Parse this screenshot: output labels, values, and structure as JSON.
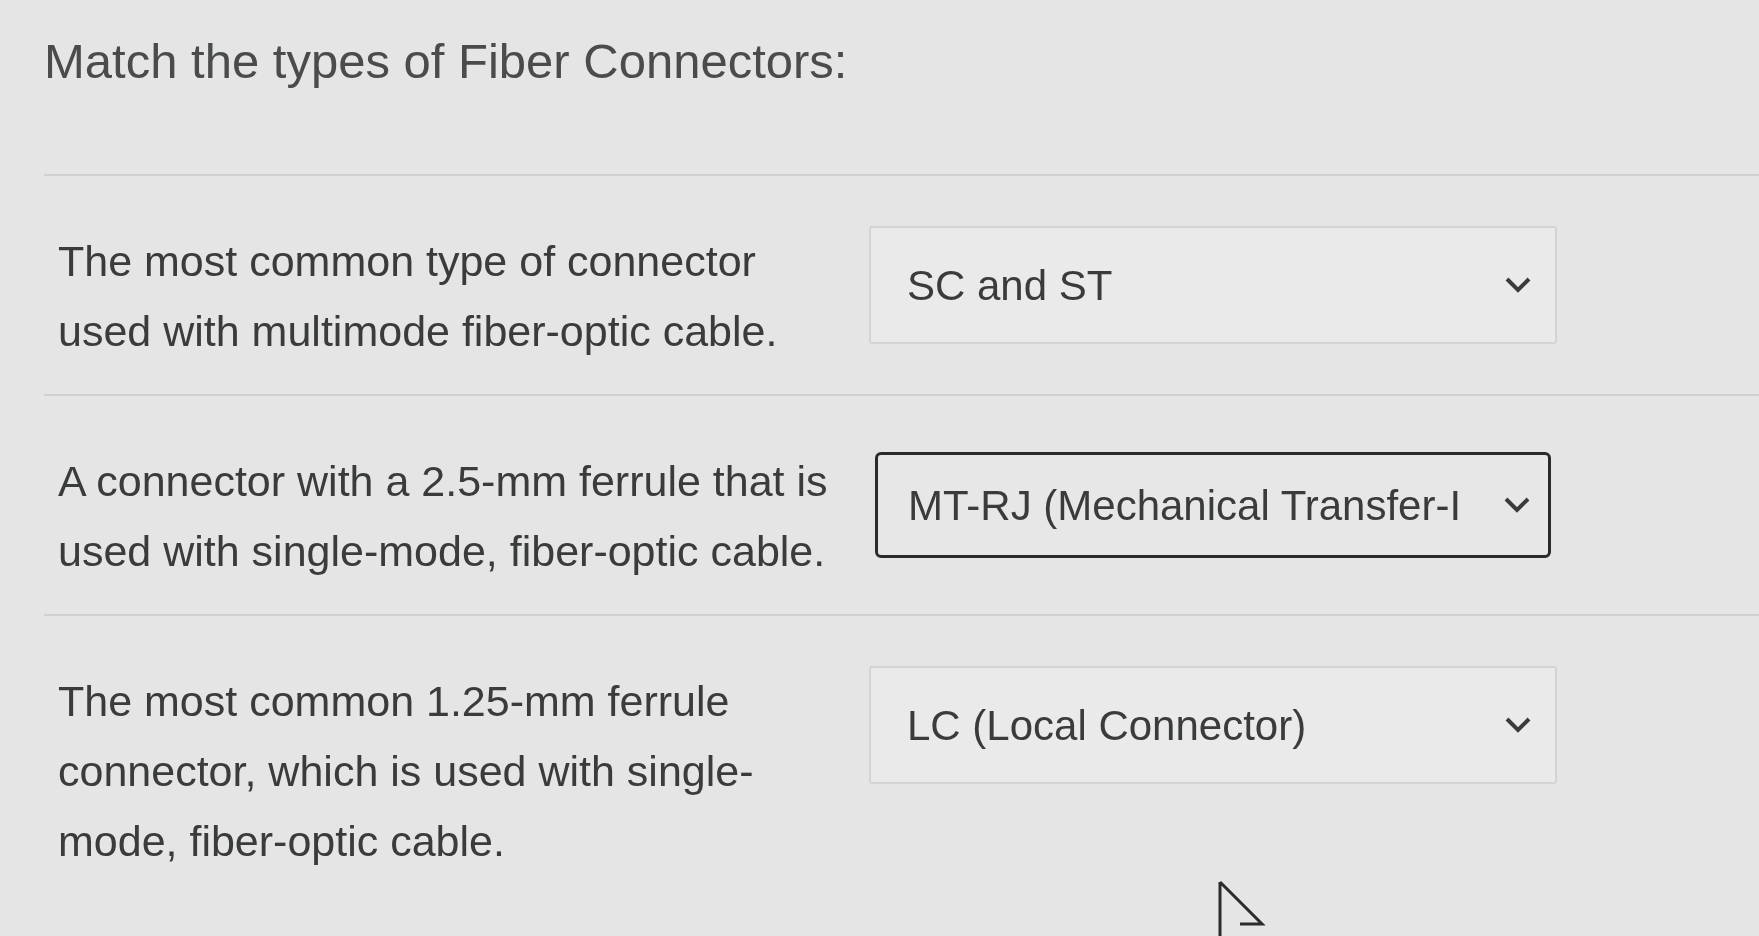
{
  "question": {
    "title": "Match the types of Fiber Connectors:"
  },
  "pairs": [
    {
      "prompt": "The most common type of connector used with multimode fiber-optic cable.",
      "answer": {
        "value": "SC and ST",
        "focused": false
      }
    },
    {
      "prompt": "A connector with a 2.5-mm ferrule that is used with single-mode, fiber-optic cable.",
      "answer": {
        "value": "MT-RJ (Mechanical Transfer-I",
        "focused": true
      }
    },
    {
      "prompt": "The most common 1.25-mm ferrule connector, which is used with single-mode, fiber-optic cable.",
      "answer": {
        "value": "LC (Local Connector)",
        "focused": false
      }
    }
  ]
}
